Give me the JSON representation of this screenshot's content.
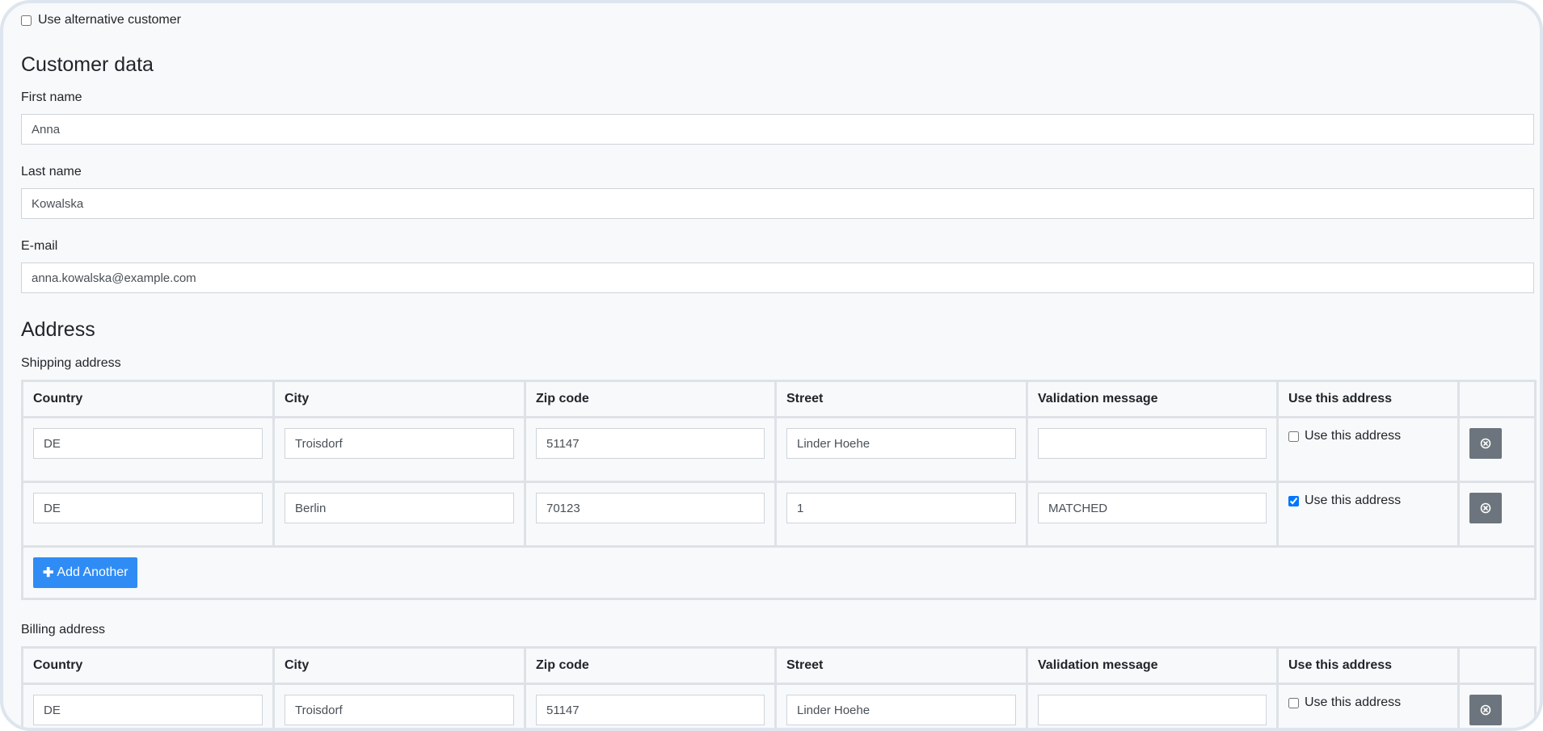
{
  "alternative_customer": {
    "label": "Use alternative customer",
    "checked": false
  },
  "customer": {
    "heading": "Customer data",
    "first_name": {
      "label": "First name",
      "value": "Anna"
    },
    "last_name": {
      "label": "Last name",
      "value": "Kowalska"
    },
    "email": {
      "label": "E-mail",
      "value": "anna.kowalska@example.com"
    }
  },
  "address": {
    "heading": "Address",
    "columns": [
      "Country",
      "City",
      "Zip code",
      "Street",
      "Validation message",
      "Use this address",
      ""
    ],
    "use_label": "Use this address",
    "remove_icon": "circle-x-icon",
    "shipping": {
      "label": "Shipping address",
      "rows": [
        {
          "country": "DE",
          "city": "Troisdorf",
          "zip": "51147",
          "street": "Linder Hoehe",
          "validation": "",
          "use": false
        },
        {
          "country": "DE",
          "city": "Berlin",
          "zip": "70123",
          "street": "1",
          "validation": "MATCHED",
          "use": true
        }
      ],
      "add_label": "Add Another"
    },
    "billing": {
      "label": "Billing address",
      "rows": [
        {
          "country": "DE",
          "city": "Troisdorf",
          "zip": "51147",
          "street": "Linder Hoehe",
          "validation": "",
          "use": false
        }
      ]
    }
  },
  "colors": {
    "primary": "#2f8cf5",
    "secondary": "#6c757d",
    "border": "#dee2e6",
    "background": "#f8f9fb"
  }
}
